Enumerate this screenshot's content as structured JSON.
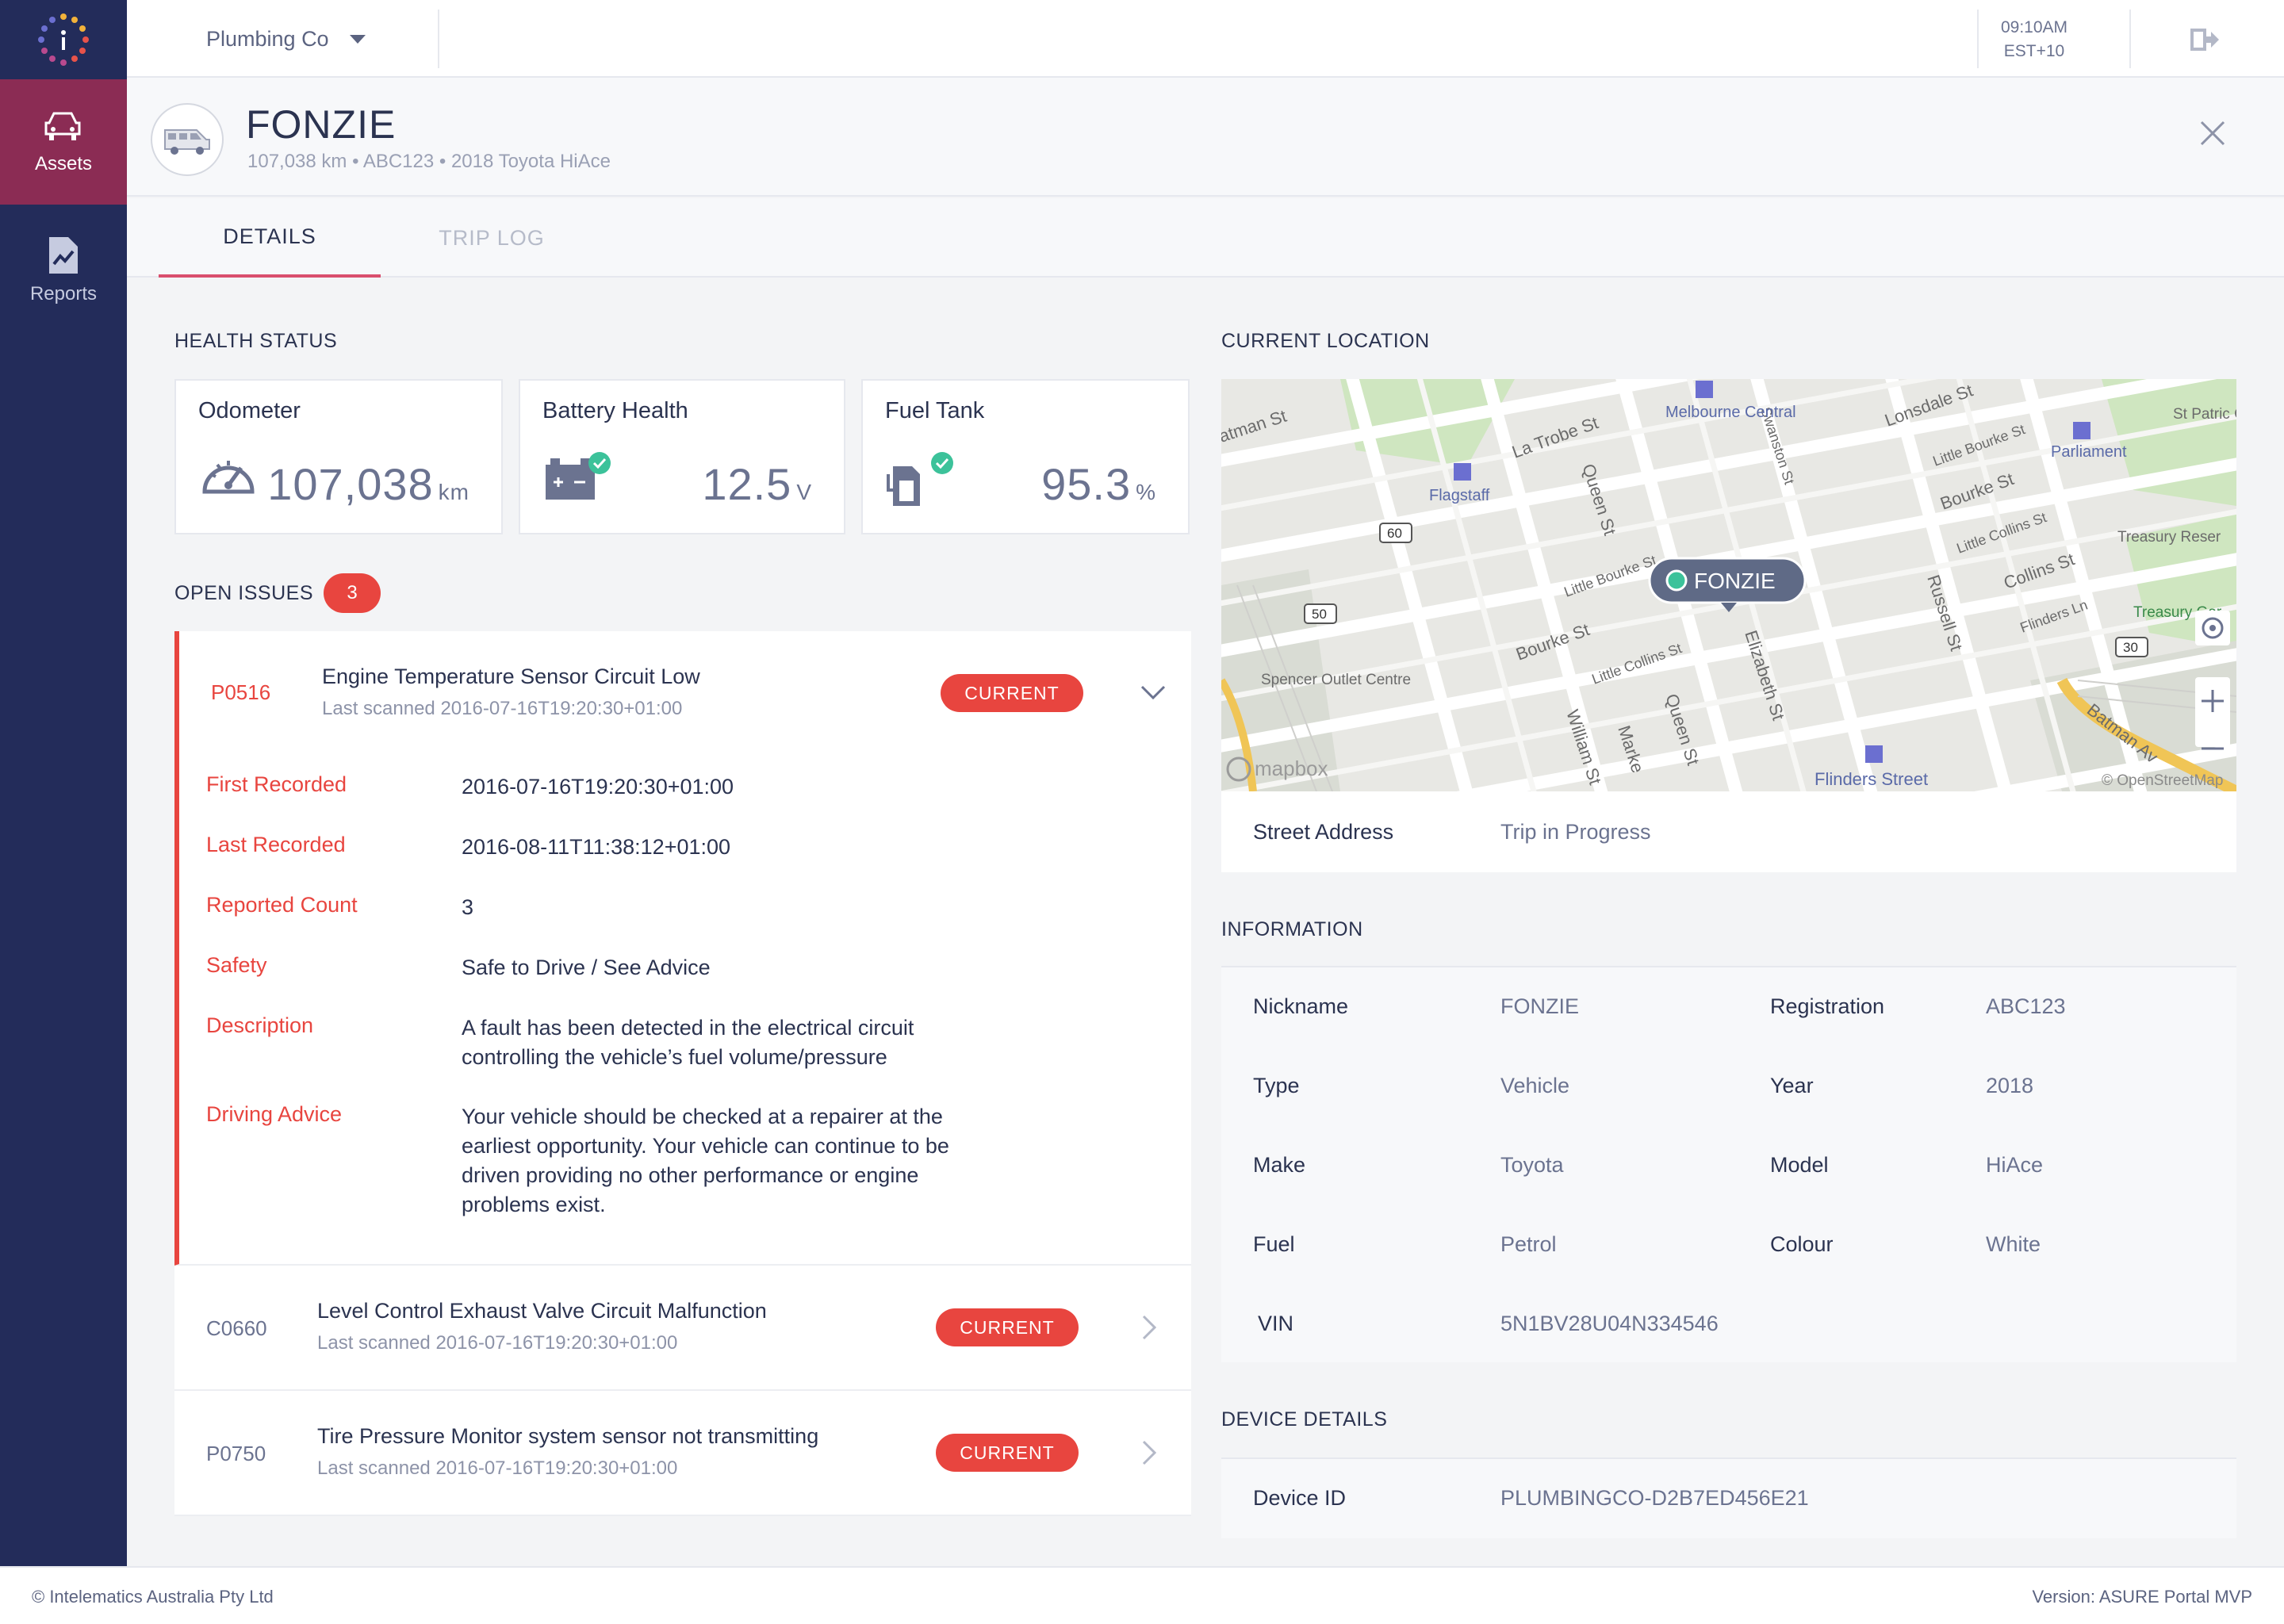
{
  "app": {
    "company": "Plumbing Co",
    "time": "09:10AM",
    "timezone": "EST+10"
  },
  "sidebar": {
    "items": [
      {
        "label": "Assets",
        "icon": "car-icon",
        "active": true
      },
      {
        "label": "Reports",
        "icon": "report-icon",
        "active": false
      }
    ]
  },
  "vehicle": {
    "name": "FONZIE",
    "subtitle": "107,038 km • ABC123 • 2018 Toyota HiAce"
  },
  "tabs": [
    {
      "label": "DETAILS",
      "active": true
    },
    {
      "label": "TRIP LOG",
      "active": false
    }
  ],
  "health": {
    "title": "HEALTH STATUS",
    "cards": [
      {
        "label": "Odometer",
        "value": "107,038",
        "unit": "km",
        "icon": "speedometer-icon"
      },
      {
        "label": "Battery Health",
        "value": "12.5",
        "unit": "V",
        "icon": "battery-icon"
      },
      {
        "label": "Fuel Tank",
        "value": "95.3",
        "unit": "%",
        "icon": "fuel-pump-icon"
      }
    ]
  },
  "issues": {
    "title": "OPEN ISSUES",
    "count": "3",
    "items": [
      {
        "code": "P0516",
        "title": "Engine Temperature Sensor Circuit Low",
        "scanned": "Last scanned 2016-07-16T19:20:30+01:00",
        "status": "CURRENT",
        "details": [
          {
            "key": "First Recorded",
            "value": "2016-07-16T19:20:30+01:00"
          },
          {
            "key": "Last Recorded",
            "value": "2016-08-11T11:38:12+01:00"
          },
          {
            "key": "Reported Count",
            "value": "3"
          },
          {
            "key": "Safety",
            "value": "Safe to Drive / See Advice"
          },
          {
            "key": "Description",
            "value": "A fault has been detected in the electrical circuit controlling the vehicle’s fuel volume/pressure"
          },
          {
            "key": "Driving Advice",
            "value": "Your vehicle should be checked at a repairer at the earliest opportunity. Your vehicle can continue to be driven providing no other performance or engine problems exist."
          }
        ]
      },
      {
        "code": "C0660",
        "title": "Level Control Exhaust Valve Circuit Malfunction",
        "scanned": "Last scanned 2016-07-16T19:20:30+01:00",
        "status": "CURRENT"
      },
      {
        "code": "P0750",
        "title": "Tire Pressure Monitor system sensor not transmitting",
        "scanned": "Last scanned 2016-07-16T19:20:30+01:00",
        "status": "CURRENT"
      }
    ]
  },
  "location": {
    "title": "CURRENT LOCATION",
    "marker_label": "FONZIE",
    "address_key": "Street Address",
    "address_value": "Trip in Progress",
    "map_labels": {
      "streets": [
        "atman St",
        "La Trobe St",
        "Lonsdale St",
        "Little Bourke St",
        "Bourke St",
        "Little Collins St",
        "Collins St",
        "Flinders Ln",
        "Swanston St",
        "Queen St",
        "Elizabeth St",
        "Russell St",
        "William St",
        "Marke",
        "Batman Av",
        "Flinders Street",
        "Little Bourke St",
        "Little Collins St",
        "Bourke St",
        "Queen St"
      ],
      "places": [
        "Melbourne Central",
        "Flagstaff",
        "Parliament",
        "St Patric Cathed",
        "Treasury Reser",
        "Treasury Gar",
        "Spencer Outlet Centre"
      ],
      "routes": [
        "60",
        "50",
        "30"
      ],
      "attribution": "© OpenStreetMap",
      "brand": "mapbox"
    }
  },
  "information": {
    "title": "INFORMATION",
    "rows": [
      [
        {
          "key": "Nickname",
          "value": "FONZIE"
        },
        {
          "key": "Registration",
          "value": "ABC123"
        }
      ],
      [
        {
          "key": "Type",
          "value": "Vehicle"
        },
        {
          "key": "Year",
          "value": "2018"
        }
      ],
      [
        {
          "key": "Make",
          "value": "Toyota"
        },
        {
          "key": "Model",
          "value": "HiAce"
        }
      ],
      [
        {
          "key": "Fuel",
          "value": "Petrol"
        },
        {
          "key": "Colour",
          "value": "White"
        }
      ],
      [
        {
          "key": "VIN",
          "value": "5N1BV28U04N334546"
        }
      ]
    ]
  },
  "device": {
    "title": "DEVICE DETAILS",
    "key": "Device ID",
    "value": "PLUMBINGCO-D2B7ED456E21"
  },
  "footer": {
    "copyright": "© Intelematics Australia Pty Ltd",
    "version": "Version: ASURE Portal MVP"
  },
  "colors": {
    "sidebar": "#232c5a",
    "sidebar_active": "#8b2c54",
    "alert": "#e8453f",
    "tab_underline": "#d94f6e",
    "ok": "#3cc29a"
  }
}
